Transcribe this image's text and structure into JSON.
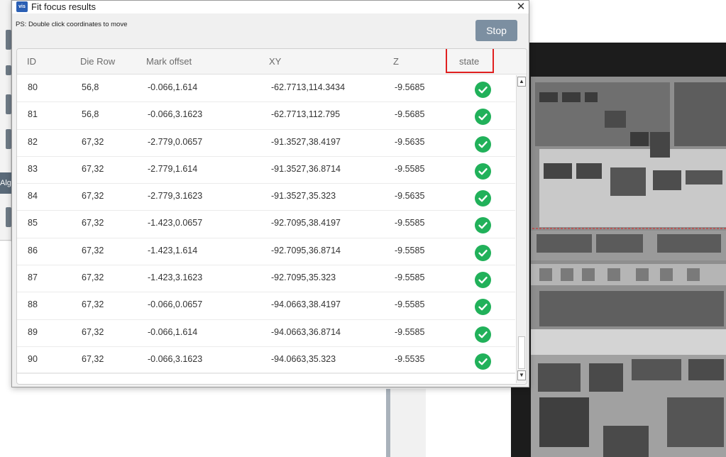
{
  "dialog": {
    "title": "Fit focus results",
    "app_icon_text": "vis",
    "close_glyph": "✕",
    "hint": "PS: Double click coordinates to move",
    "stop_label": "Stop"
  },
  "background": {
    "alg_tab_label": "Alg"
  },
  "table": {
    "columns": [
      "ID",
      "Die Row",
      "Mark offset",
      "XY",
      "Z",
      "state"
    ],
    "rows": [
      {
        "id": "80",
        "die_row": "56,8",
        "mark_offset": "-0.066,1.614",
        "xy": "-62.7713,114.3434",
        "z": "-9.5685",
        "state": "success"
      },
      {
        "id": "81",
        "die_row": "56,8",
        "mark_offset": "-0.066,3.1623",
        "xy": "-62.7713,112.795",
        "z": "-9.5685",
        "state": "success"
      },
      {
        "id": "82",
        "die_row": "67,32",
        "mark_offset": "-2.779,0.0657",
        "xy": "-91.3527,38.4197",
        "z": "-9.5635",
        "state": "success"
      },
      {
        "id": "83",
        "die_row": "67,32",
        "mark_offset": "-2.779,1.614",
        "xy": "-91.3527,36.8714",
        "z": "-9.5585",
        "state": "success"
      },
      {
        "id": "84",
        "die_row": "67,32",
        "mark_offset": "-2.779,3.1623",
        "xy": "-91.3527,35.323",
        "z": "-9.5635",
        "state": "success"
      },
      {
        "id": "85",
        "die_row": "67,32",
        "mark_offset": "-1.423,0.0657",
        "xy": "-92.7095,38.4197",
        "z": "-9.5585",
        "state": "success"
      },
      {
        "id": "86",
        "die_row": "67,32",
        "mark_offset": "-1.423,1.614",
        "xy": "-92.7095,36.8714",
        "z": "-9.5585",
        "state": "success"
      },
      {
        "id": "87",
        "die_row": "67,32",
        "mark_offset": "-1.423,3.1623",
        "xy": "-92.7095,35.323",
        "z": "-9.5585",
        "state": "success"
      },
      {
        "id": "88",
        "die_row": "67,32",
        "mark_offset": "-0.066,0.0657",
        "xy": "-94.0663,38.4197",
        "z": "-9.5585",
        "state": "success"
      },
      {
        "id": "89",
        "die_row": "67,32",
        "mark_offset": "-0.066,1.614",
        "xy": "-94.0663,36.8714",
        "z": "-9.5585",
        "state": "success"
      },
      {
        "id": "90",
        "die_row": "67,32",
        "mark_offset": "-0.066,3.1623",
        "xy": "-94.0663,35.323",
        "z": "-9.5535",
        "state": "success"
      }
    ],
    "state_icon": "check-circle-icon",
    "success_color": "#21b15a",
    "highlight_color": "#e02020"
  },
  "scrollbar": {
    "up_glyph": "▲",
    "down_glyph": "▼"
  }
}
